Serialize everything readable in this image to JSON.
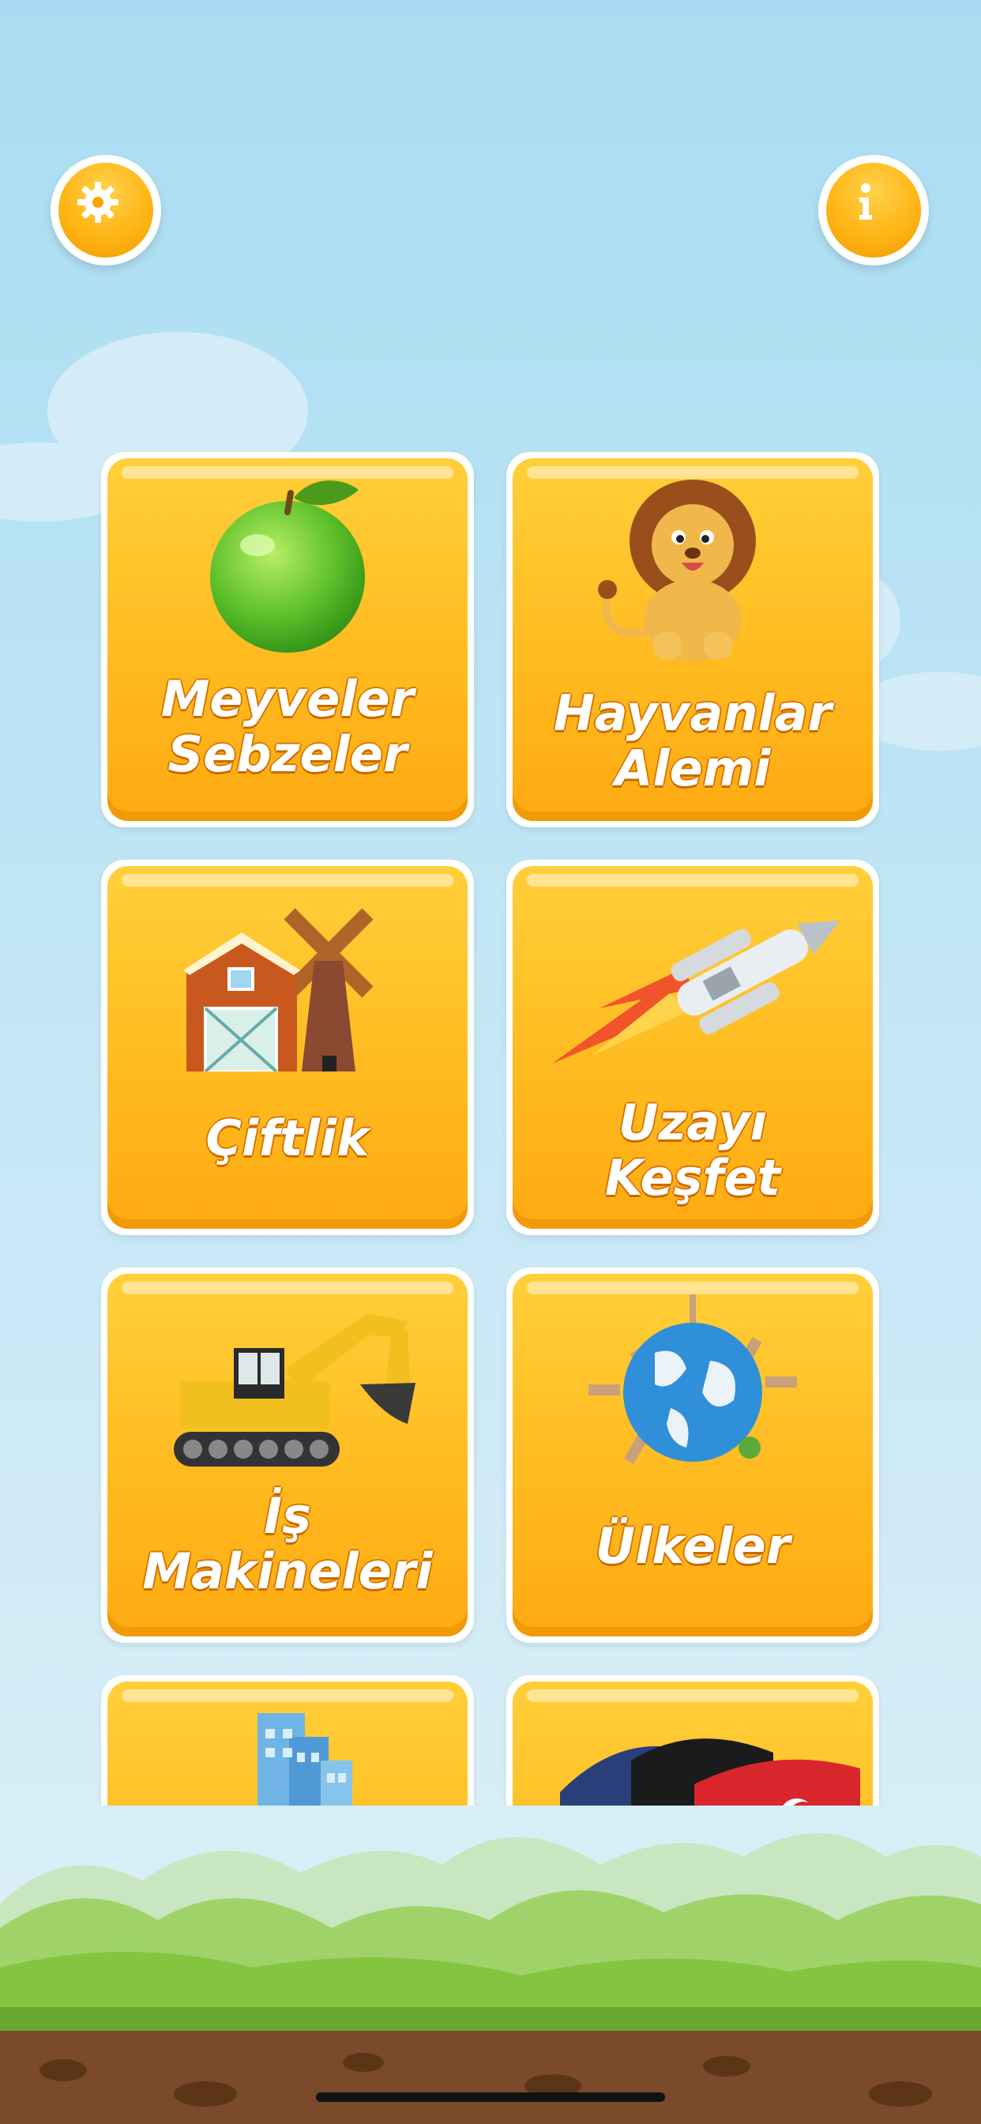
{
  "top_bar": {
    "settings_icon": "gear-icon",
    "info_icon": "info-icon"
  },
  "colors": {
    "sky": "#a9dcf2",
    "tile_orange": "#ffbb20",
    "tile_border": "#ffffff",
    "label_text": "#ffffff",
    "grass": "#8fcc3a",
    "soil": "#7a4a2a"
  },
  "categories": [
    {
      "label": "Meyveler\nSebzeler",
      "icon": "apple-icon"
    },
    {
      "label": "Hayvanlar\nAlemi",
      "icon": "lion-icon"
    },
    {
      "label": "Çiftlik",
      "icon": "farm-windmill-icon"
    },
    {
      "label": "Uzayı\nKeşfet",
      "icon": "rocket-icon"
    },
    {
      "label": "İş\nMakineleri",
      "icon": "excavator-icon"
    },
    {
      "label": "Ülkeler",
      "icon": "globe-icon"
    },
    {
      "label": "",
      "icon": "buildings-icon"
    },
    {
      "label": "",
      "icon": "flags-icon"
    }
  ]
}
